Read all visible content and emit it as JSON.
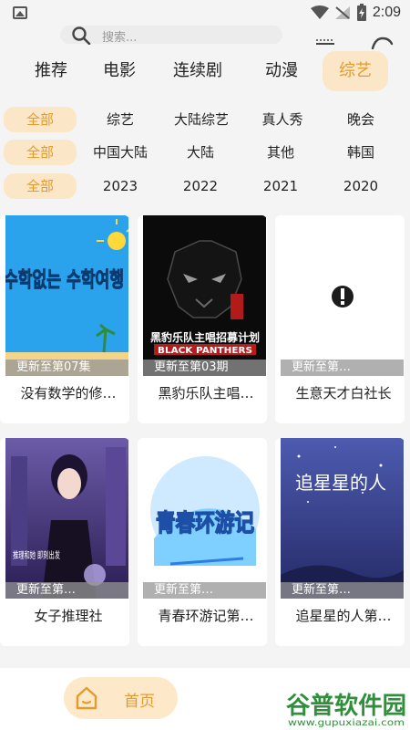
{
  "status_bar": {
    "time": "2:09"
  },
  "search": {
    "placeholder": "搜索..."
  },
  "tabs": [
    {
      "label": "推荐"
    },
    {
      "label": "电影"
    },
    {
      "label": "连续剧"
    },
    {
      "label": "动漫"
    },
    {
      "label": "综艺"
    }
  ],
  "filters": {
    "type": {
      "all": "全部",
      "items": [
        "综艺",
        "大陆综艺",
        "真人秀",
        "晚会"
      ]
    },
    "region": {
      "all": "全部",
      "items": [
        "中国大陆",
        "大陆",
        "其他",
        "韩国"
      ]
    },
    "year": {
      "all": "全部",
      "items": [
        "2023",
        "2022",
        "2021",
        "2020"
      ]
    }
  },
  "cards": [
    {
      "title": "没有数学的修…",
      "badge": "更新至第07集",
      "poster_text": "수학없는 수학여행"
    },
    {
      "title": "黑豹乐队主唱…",
      "badge": "更新至第03期",
      "poster_text": "黑豹乐队主唱招募计划",
      "poster_sub": "BLACK PANTHERS"
    },
    {
      "title": "生意天才白社长",
      "badge": "更新至第…"
    },
    {
      "title": "女子推理社",
      "badge": "更新至第…",
      "poster_text": "推理和她 即刻出发"
    },
    {
      "title": "青春环游记第…",
      "badge": "更新至第…",
      "poster_text": "青春环游记"
    },
    {
      "title": "追星星的人第…",
      "badge": "更新至第…",
      "poster_text": "追星星的人"
    }
  ],
  "bottom_nav": {
    "home_label": "首页"
  },
  "watermark": {
    "title": "谷普软件园",
    "url": "www.gupuxiazai.com"
  },
  "colors": {
    "accent": "#e39b2e",
    "accent_bg": "#fbe7c7"
  }
}
